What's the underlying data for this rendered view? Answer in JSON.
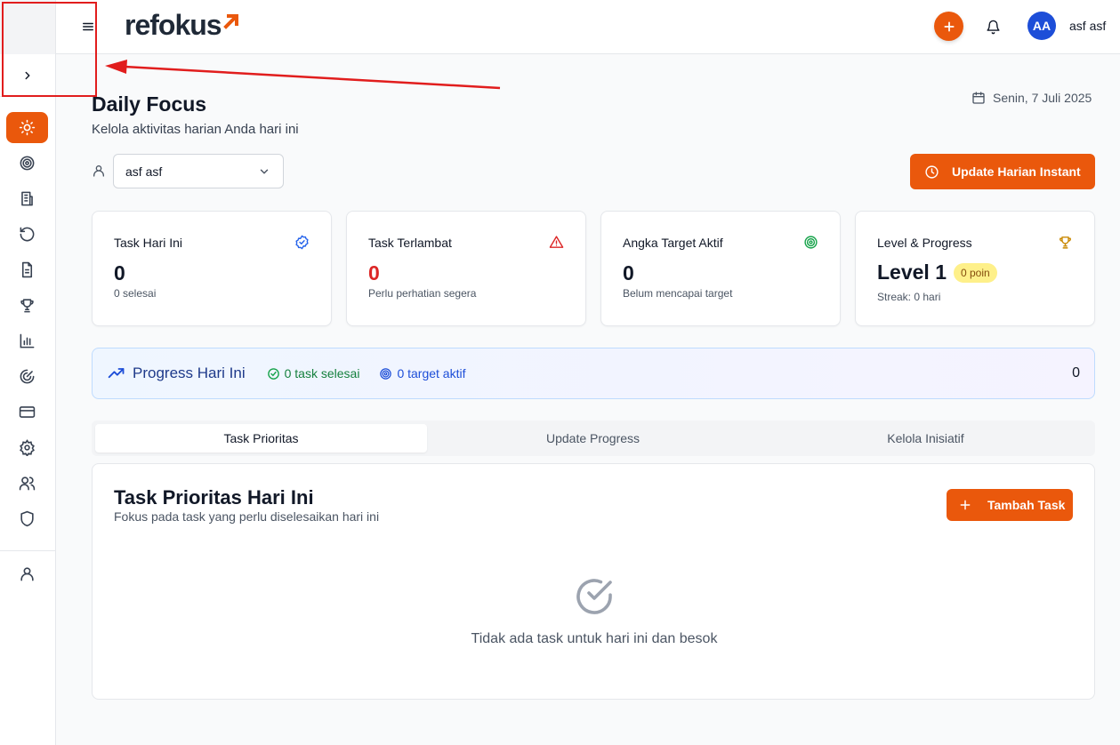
{
  "app": {
    "logo_text": "refokus",
    "brand_color": "#ea580c"
  },
  "header": {
    "user_initials": "AA",
    "user_name": "asf asf",
    "icons": [
      "menu-icon",
      "plus-icon",
      "bell-icon"
    ]
  },
  "sidebar": {
    "items": [
      {
        "icon": "sun-icon",
        "active": true
      },
      {
        "icon": "target-icon"
      },
      {
        "icon": "building-icon"
      },
      {
        "icon": "history-icon"
      },
      {
        "icon": "document-icon"
      },
      {
        "icon": "trophy-icon"
      },
      {
        "icon": "bar-chart-icon"
      },
      {
        "icon": "gauge-icon"
      },
      {
        "icon": "credit-card-icon"
      },
      {
        "icon": "gear-icon"
      },
      {
        "icon": "users-icon"
      },
      {
        "icon": "shield-icon"
      },
      {
        "icon": "user-icon"
      }
    ]
  },
  "page": {
    "title": "Daily Focus",
    "subtitle": "Kelola aktivitas harian Anda hari ini",
    "date": "Senin, 7 Juli 2025",
    "user_select_value": "asf asf",
    "update_button": "Update Harian Instant"
  },
  "cards": {
    "today": {
      "title": "Task Hari Ini",
      "value": "0",
      "note": "0 selesai"
    },
    "late": {
      "title": "Task Terlambat",
      "value": "0",
      "note": "Perlu perhatian segera"
    },
    "target": {
      "title": "Angka Target Aktif",
      "value": "0",
      "note": "Belum mencapai target"
    },
    "level": {
      "title": "Level & Progress",
      "value": "Level 1",
      "badge": "0 poin",
      "note": "Streak: 0 hari"
    }
  },
  "progress": {
    "title": "Progress Hari Ini",
    "done": "0 task selesai",
    "targets": "0 target aktif",
    "count": "0"
  },
  "tabs": [
    {
      "label": "Task Prioritas",
      "active": true
    },
    {
      "label": "Update Progress"
    },
    {
      "label": "Kelola Inisiatif"
    }
  ],
  "tasks": {
    "title": "Task Prioritas Hari Ini",
    "subtitle": "Fokus pada task yang perlu diselesaikan hari ini",
    "add_button": "Tambah Task",
    "empty_text": "Tidak ada task untuk hari ini dan besok"
  }
}
